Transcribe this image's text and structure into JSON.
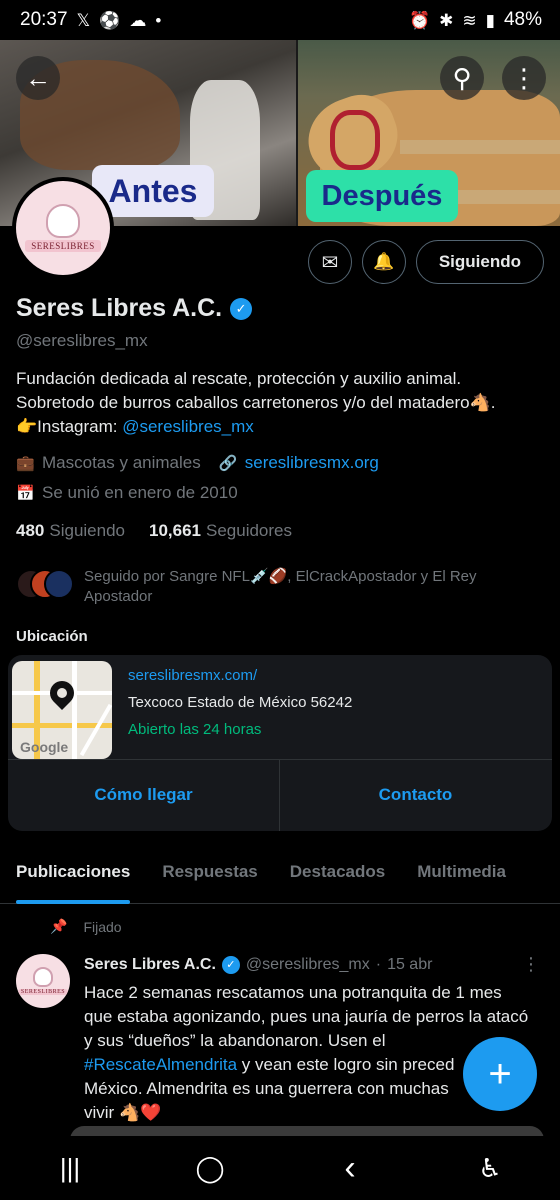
{
  "status_bar": {
    "time": "20:37",
    "left_icons": [
      "x-icon",
      "soccer-icon",
      "cloud-icon",
      "dot-icon"
    ],
    "right_icons": [
      "alarm-icon",
      "bluetooth-icon",
      "wifi-icon",
      "signal-icon"
    ],
    "battery": "48%"
  },
  "banner": {
    "before_label": "Antes",
    "after_label": "Después"
  },
  "header_buttons": {
    "back": "←",
    "search": "⚲",
    "more": "⋮"
  },
  "avatar": {
    "label": "SERESLIBRES"
  },
  "actions": {
    "message_icon": "✉",
    "notify_icon": "🔔",
    "follow_label": "Siguiendo"
  },
  "profile": {
    "name": "Seres Libres A.C.",
    "verified_mark": "✓",
    "handle": "@sereslibres_mx",
    "bio_line1": "Fundación dedicada al rescate, protección y auxilio animal.",
    "bio_line2": "Sobretodo de burros caballos carretoneros y/o del matadero🐴.",
    "bio_line3_prefix": "👉Instagram: ",
    "bio_line3_link": "@sereslibres_mx",
    "category": "Mascotas y animales",
    "website": "sereslibresmx.org",
    "joined": "Se unió en enero de 2010",
    "following_count": "480",
    "following_label": "Siguiendo",
    "followers_count": "10,661",
    "followers_label": "Seguidores",
    "followed_by_line1": "Seguido por Sangre NFL💉🏈, ElCrackApostador y El Rey",
    "followed_by_line2": "Apostador"
  },
  "location": {
    "title": "Ubicación",
    "url": "sereslibresmx.com/",
    "address": "Texcoco Estado de México  56242",
    "hours": "Abierto las 24 horas",
    "map_brand": "Google",
    "directions_label": "Cómo llegar",
    "contact_label": "Contacto"
  },
  "tabs": [
    {
      "label": "Publicaciones",
      "active": true
    },
    {
      "label": "Respuestas",
      "active": false
    },
    {
      "label": "Destacados",
      "active": false
    },
    {
      "label": "Multimedia",
      "active": false
    }
  ],
  "pinned_post": {
    "pinned_label": "Fijado",
    "author": "Seres Libres A.C.",
    "handle": "@sereslibres_mx",
    "separator": "·",
    "date": "15 abr",
    "text_line1": "Hace 2 semanas rescatamos una potranquita de 1 mes",
    "text_line2": "que estaba agonizando, pues una jauría de perros la atacó",
    "text_line3": "y sus “dueños” la abandonaron. Usen el",
    "text_hashtag": "#RescateAlmendrita",
    "text_line4_rest": " y vean este logro sin preced",
    "text_line5": "México. Almendrita es una guerrera con muchas",
    "text_line6": "vivir 🐴❤️"
  },
  "fab_label": "+",
  "nav_bar": {
    "recents": "|||",
    "home": "◯",
    "back": "‹",
    "accessibility": "♿"
  },
  "colors": {
    "accent": "#1d9bf0",
    "open_status": "#00ba7c",
    "secondary_text": "#71767b",
    "background": "#000000"
  }
}
